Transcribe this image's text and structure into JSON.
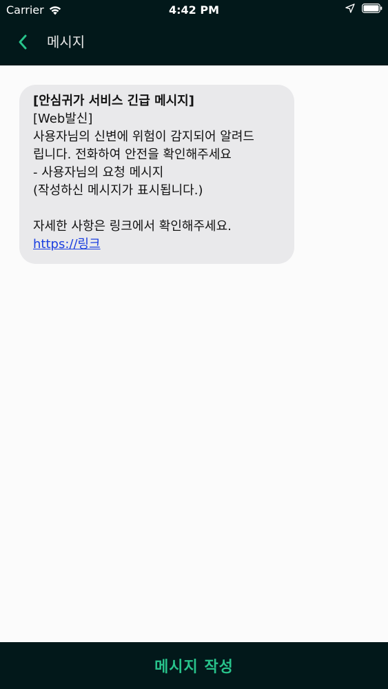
{
  "status_bar": {
    "carrier": "Carrier",
    "time": "4:42 PM"
  },
  "nav": {
    "title": "메시지"
  },
  "message": {
    "header": "[안심귀가 서비스 긴급 메시지]",
    "source": "[Web발신]",
    "body_line1": "사용자님의 신변에 위험이 감지되어 알려드",
    "body_line2": "립니다. 전화하여 안전을 확인해주세요",
    "body_line3": "- 사용자님의 요청 메시지",
    "body_line4": "(작성하신 메시지가 표시됩니다.)",
    "body_line5": "자세한 사항은 링크에서 확인해주세요.",
    "link": "https://링크"
  },
  "bottom": {
    "compose_label": "메시지 작성"
  },
  "colors": {
    "header_bg": "#02181a",
    "accent": "#28c38b",
    "bubble_bg": "#e9e9eb",
    "link": "#1a3ee0"
  },
  "icons": {
    "back": "chevron-left-icon",
    "wifi": "wifi-icon",
    "location": "location-arrow-icon",
    "battery": "battery-icon"
  }
}
